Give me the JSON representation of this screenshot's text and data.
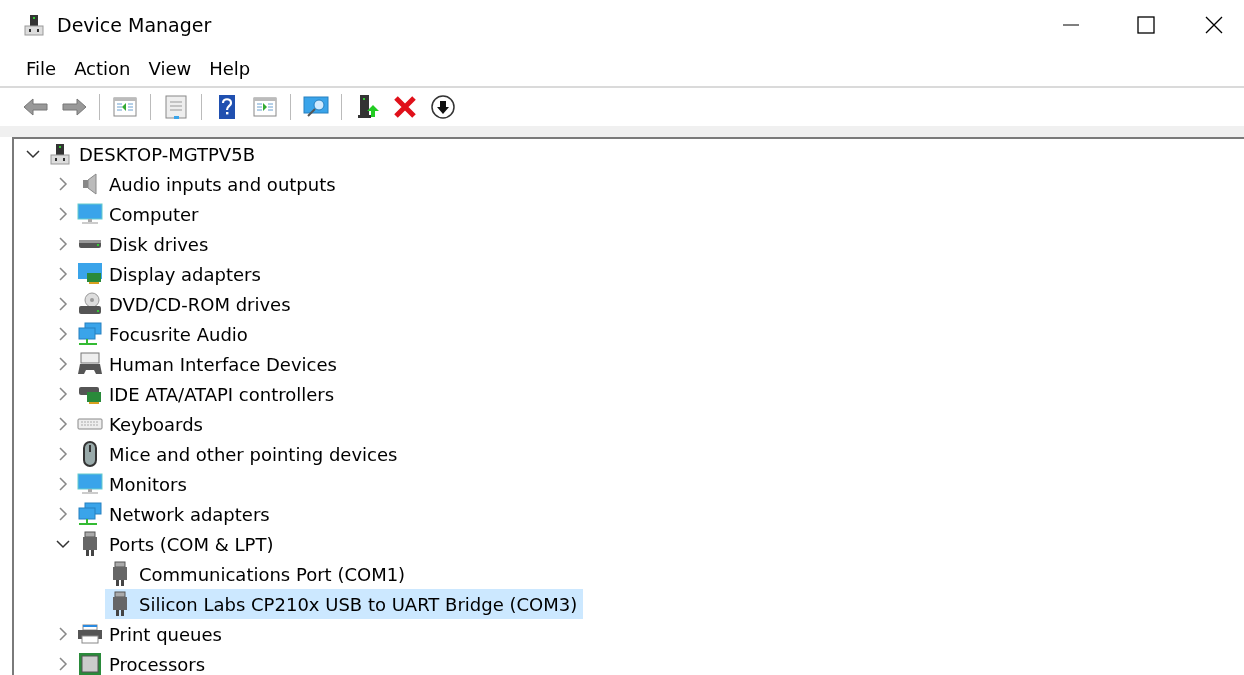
{
  "window": {
    "title": "Device Manager"
  },
  "menu": [
    "File",
    "Action",
    "View",
    "Help"
  ],
  "tree": {
    "label": "DESKTOP-MGTPV5B",
    "expanded": true,
    "selected": false,
    "children": [
      {
        "label": "Audio inputs and outputs",
        "expanded": false,
        "selected": false
      },
      {
        "label": "Computer",
        "expanded": false,
        "selected": false
      },
      {
        "label": "Disk drives",
        "expanded": false,
        "selected": false
      },
      {
        "label": "Display adapters",
        "expanded": false,
        "selected": false
      },
      {
        "label": "DVD/CD-ROM drives",
        "expanded": false,
        "selected": false
      },
      {
        "label": "Focusrite Audio",
        "expanded": false,
        "selected": false
      },
      {
        "label": "Human Interface Devices",
        "expanded": false,
        "selected": false
      },
      {
        "label": "IDE ATA/ATAPI controllers",
        "expanded": false,
        "selected": false
      },
      {
        "label": "Keyboards",
        "expanded": false,
        "selected": false
      },
      {
        "label": "Mice and other pointing devices",
        "expanded": false,
        "selected": false
      },
      {
        "label": "Monitors",
        "expanded": false,
        "selected": false
      },
      {
        "label": "Network adapters",
        "expanded": false,
        "selected": false
      },
      {
        "label": "Ports (COM & LPT)",
        "expanded": true,
        "selected": false,
        "children": [
          {
            "label": "Communications Port (COM1)",
            "selected": false
          },
          {
            "label": "Silicon Labs CP210x USB to UART Bridge (COM3)",
            "selected": true
          }
        ]
      },
      {
        "label": "Print queues",
        "expanded": false,
        "selected": false
      },
      {
        "label": "Processors",
        "expanded": false,
        "selected": false
      }
    ]
  }
}
